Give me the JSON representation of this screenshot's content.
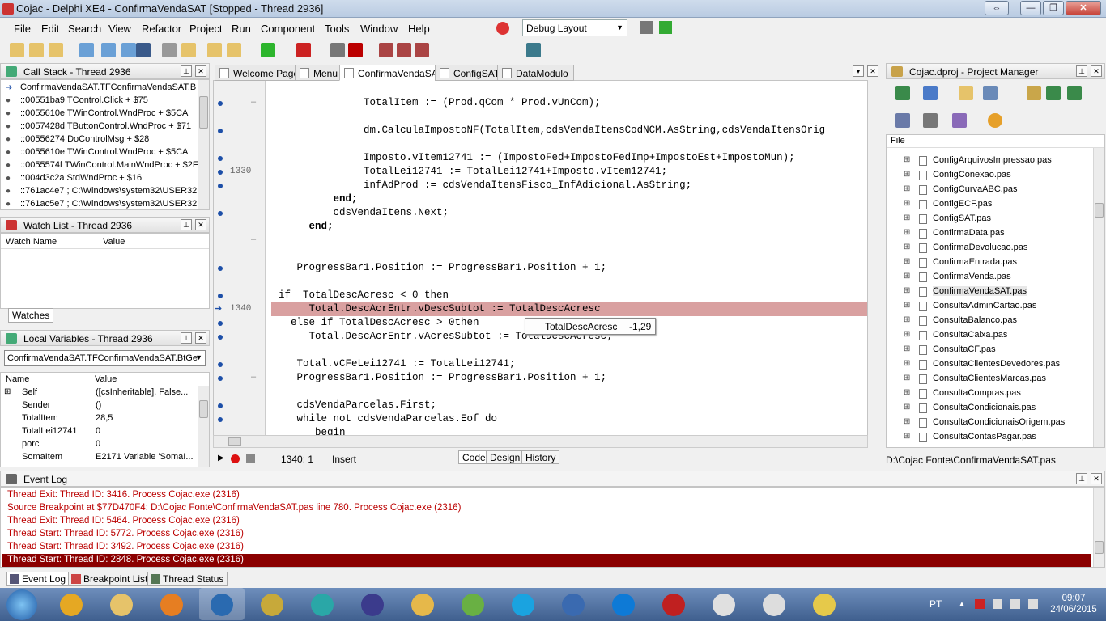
{
  "window": {
    "title": "Cojac - Delphi XE4 - ConfirmaVendaSAT [Stopped - Thread 2936]"
  },
  "menu": [
    "File",
    "Edit",
    "Search",
    "View",
    "Refactor",
    "Project",
    "Run",
    "Component",
    "Tools",
    "Window",
    "Help"
  ],
  "layout_select": "Debug Layout",
  "callstack": {
    "title": "Call Stack - Thread 2936",
    "rows": [
      "ConfirmaVendaSAT.TFConfirmaVendaSAT.B",
      "::00551ba9 TControl.Click + $75",
      "::0055610e TWinControl.WndProc + $5CA",
      "::0057428d TButtonControl.WndProc + $71",
      "::00556274 DoControlMsg + $28",
      "::0055610e TWinControl.WndProc + $5CA",
      "::0055574f TWinControl.MainWndProc + $2F",
      "::004d3c2a StdWndProc + $16",
      "::761ac4e7 ; C:\\Windows\\system32\\USER32",
      "::761ac5e7 ; C:\\Windows\\system32\\USER32"
    ]
  },
  "watch": {
    "title": "Watch List - Thread 2936",
    "col_name": "Watch Name",
    "col_value": "Value",
    "tab": "Watches"
  },
  "locals": {
    "title": "Local Variables - Thread 2936",
    "combo": "ConfirmaVendaSAT.TFConfirmaVendaSAT.BtGe",
    "col_name": "Name",
    "col_value": "Value",
    "rows": [
      {
        "n": "Self",
        "v": "([csInheritable], False..."
      },
      {
        "n": "Sender",
        "v": "()"
      },
      {
        "n": "TotalItem",
        "v": "28,5"
      },
      {
        "n": "TotalLei12741",
        "v": "0"
      },
      {
        "n": "porc",
        "v": "0"
      },
      {
        "n": "SomaItem",
        "v": "E2171 Variable 'SomaI..."
      }
    ]
  },
  "tabs": [
    "Welcome Page",
    "Menu",
    "ConfirmaVendaSAT",
    "ConfigSAT",
    "DataModulo"
  ],
  "code": [
    {
      "t": "              TotalItem := (Prod.qCom * Prod.vUnCom);",
      "bp": true,
      "fold": "–"
    },
    {
      "t": "",
      "bp": false
    },
    {
      "t": "              dm.CalculaImpostoNF(TotalItem,cdsVendaItensCodNCM.AsString,cdsVendaItensOrig",
      "bp": true
    },
    {
      "t": "",
      "bp": false
    },
    {
      "t": "              Imposto.vItem12741 := (ImpostoFed+ImpostoFedImp+ImpostoEst+ImpostoMun);",
      "bp": true
    },
    {
      "t": "              TotalLei12741 := TotalLei12741+Imposto.vItem12741;",
      "bp": true,
      "num": "1330"
    },
    {
      "t": "              infAdProd := cdsVendaItensFisco_InfAdicional.AsString;",
      "bp": true
    },
    {
      "t": "         end;",
      "bp": false,
      "kw": true
    },
    {
      "t": "         cdsVendaItens.Next;",
      "bp": true
    },
    {
      "t": "     end;",
      "bp": false,
      "kw": true
    },
    {
      "t": "",
      "bp": false,
      "fold": "–"
    },
    {
      "t": "",
      "bp": false
    },
    {
      "t": "   ProgressBar1.Position := ProgressBar1.Position + 1;",
      "bp": true
    },
    {
      "t": "",
      "bp": false
    },
    {
      "t": "if  TotalDescAcresc < 0 then",
      "bp": true
    },
    {
      "t": "     Total.DescAcrEntr.vDescSubtot := TotalDescAcresc",
      "bp": false,
      "cur": true,
      "num": "1340"
    },
    {
      "t": "  else if TotalDescAcresc > 0then",
      "bp": true
    },
    {
      "t": "     Total.DescAcrEntr.vAcresSubtot := TotalDescAcresc;",
      "bp": true
    },
    {
      "t": "",
      "bp": false
    },
    {
      "t": "   Total.vCFeLei12741 := TotalLei12741;",
      "bp": true
    },
    {
      "t": "   ProgressBar1.Position := ProgressBar1.Position + 1;",
      "bp": true,
      "fold": "–"
    },
    {
      "t": "",
      "bp": false
    },
    {
      "t": "   cdsVendaParcelas.First;",
      "bp": true
    },
    {
      "t": "   while not cdsVendaParcelas.Eof do",
      "bp": true
    },
    {
      "t": "      begin",
      "bp": false
    }
  ],
  "tooltip": {
    "name": "TotalDescAcresc",
    "value": "-1,29"
  },
  "status": {
    "pos": "1340:   1",
    "mode": "Insert",
    "tabs": [
      "Code",
      "Design",
      "History"
    ]
  },
  "project": {
    "title": "Cojac.dproj - Project Manager",
    "col": "File",
    "files": [
      "ConfigArquivosImpressao.pas",
      "ConfigConexao.pas",
      "ConfigCurvaABC.pas",
      "ConfigECF.pas",
      "ConfigSAT.pas",
      "ConfirmaData.pas",
      "ConfirmaDevolucao.pas",
      "ConfirmaEntrada.pas",
      "ConfirmaVenda.pas",
      "ConfirmaVendaSAT.pas",
      "ConsultaAdminCartao.pas",
      "ConsultaBalanco.pas",
      "ConsultaCaixa.pas",
      "ConsultaCF.pas",
      "ConsultaClientesDevedores.pas",
      "ConsultaClientesMarcas.pas",
      "ConsultaCompras.pas",
      "ConsultaCondicionais.pas",
      "ConsultaCondicionaisOrigem.pas",
      "ConsultaContasPagar.pas"
    ],
    "path": "D:\\Cojac Fonte\\ConfirmaVendaSAT.pas"
  },
  "eventlog": {
    "title": "Event Log",
    "rows": [
      "Thread Exit: Thread ID: 3416. Process Cojac.exe (2316)",
      "Source Breakpoint at $77D470F4: D:\\Cojac Fonte\\ConfirmaVendaSAT.pas line 780. Process Cojac.exe (2316)",
      "Thread Exit: Thread ID: 5464. Process Cojac.exe (2316)",
      "Thread Start: Thread ID: 5772. Process Cojac.exe (2316)",
      "Thread Start: Thread ID: 3492. Process Cojac.exe (2316)",
      "Thread Start: Thread ID: 2848. Process Cojac.exe (2316)"
    ],
    "tabs": [
      "Event Log",
      "Breakpoint List",
      "Thread Status"
    ]
  },
  "taskbar": {
    "lang": "PT",
    "time": "09:07",
    "date": "24/06/2015"
  }
}
